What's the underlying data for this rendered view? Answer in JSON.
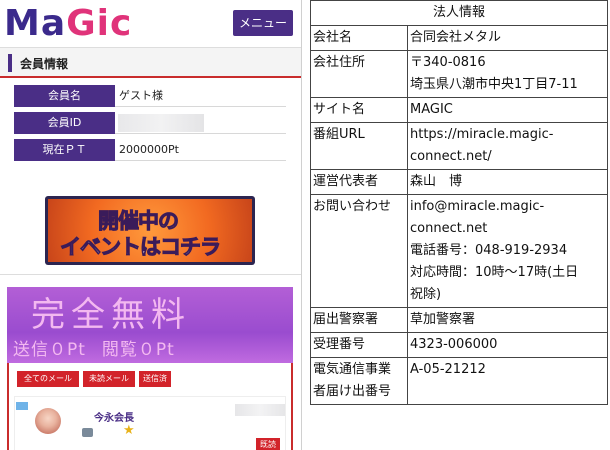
{
  "header": {
    "logo_part1": "Ma",
    "logo_part2": "Gic",
    "menu_label": "メニュー",
    "logo_colors": {
      "primary": "#3b2a8c",
      "accent": "#e0337a"
    }
  },
  "member": {
    "section_title": "会員情報",
    "rows": [
      {
        "label": "会員名",
        "value": "ゲスト様"
      },
      {
        "label": "会員ID",
        "value": ""
      },
      {
        "label": "現在ＰＴ",
        "value": "2000000Pt"
      }
    ]
  },
  "event_banner": {
    "line1": "開催中の",
    "line2": "イベントはコチラ"
  },
  "free_banner": {
    "headline": "完全無料",
    "send": "送信０Pt",
    "view": "閲覧０Pt"
  },
  "mail_tabs": [
    "全てのメール",
    "未読メール",
    "送信済"
  ],
  "message": {
    "sender": "今永会長",
    "read_label": "既読"
  },
  "corp_info": {
    "title": "法人情報",
    "rows": [
      {
        "key": "会社名",
        "value": [
          "合同会社メタル"
        ]
      },
      {
        "key": "会社住所",
        "value": [
          "〒340-0816",
          "埼玉県八潮市中央1丁目7-11"
        ]
      },
      {
        "key": "サイト名",
        "value": [
          "MAGIC"
        ]
      },
      {
        "key": "番組URL",
        "value": [
          "https://miracle.magic-",
          "connect.net/"
        ]
      },
      {
        "key": "運営代表者",
        "value": [
          "森山　博"
        ]
      },
      {
        "key": "お問い合わせ",
        "value": [
          "info@miracle.magic-",
          "connect.net",
          "電話番号：048-919-2934",
          "対応時間：10時～17時(土日",
          "祝除)"
        ]
      },
      {
        "key": "届出警察署",
        "value": [
          "草加警察署"
        ]
      },
      {
        "key": "受理番号",
        "value": [
          "4323-006000"
        ]
      },
      {
        "key": [
          "電気通信事業",
          "者届け出番号"
        ],
        "value": [
          "A-05-21212"
        ]
      }
    ]
  }
}
